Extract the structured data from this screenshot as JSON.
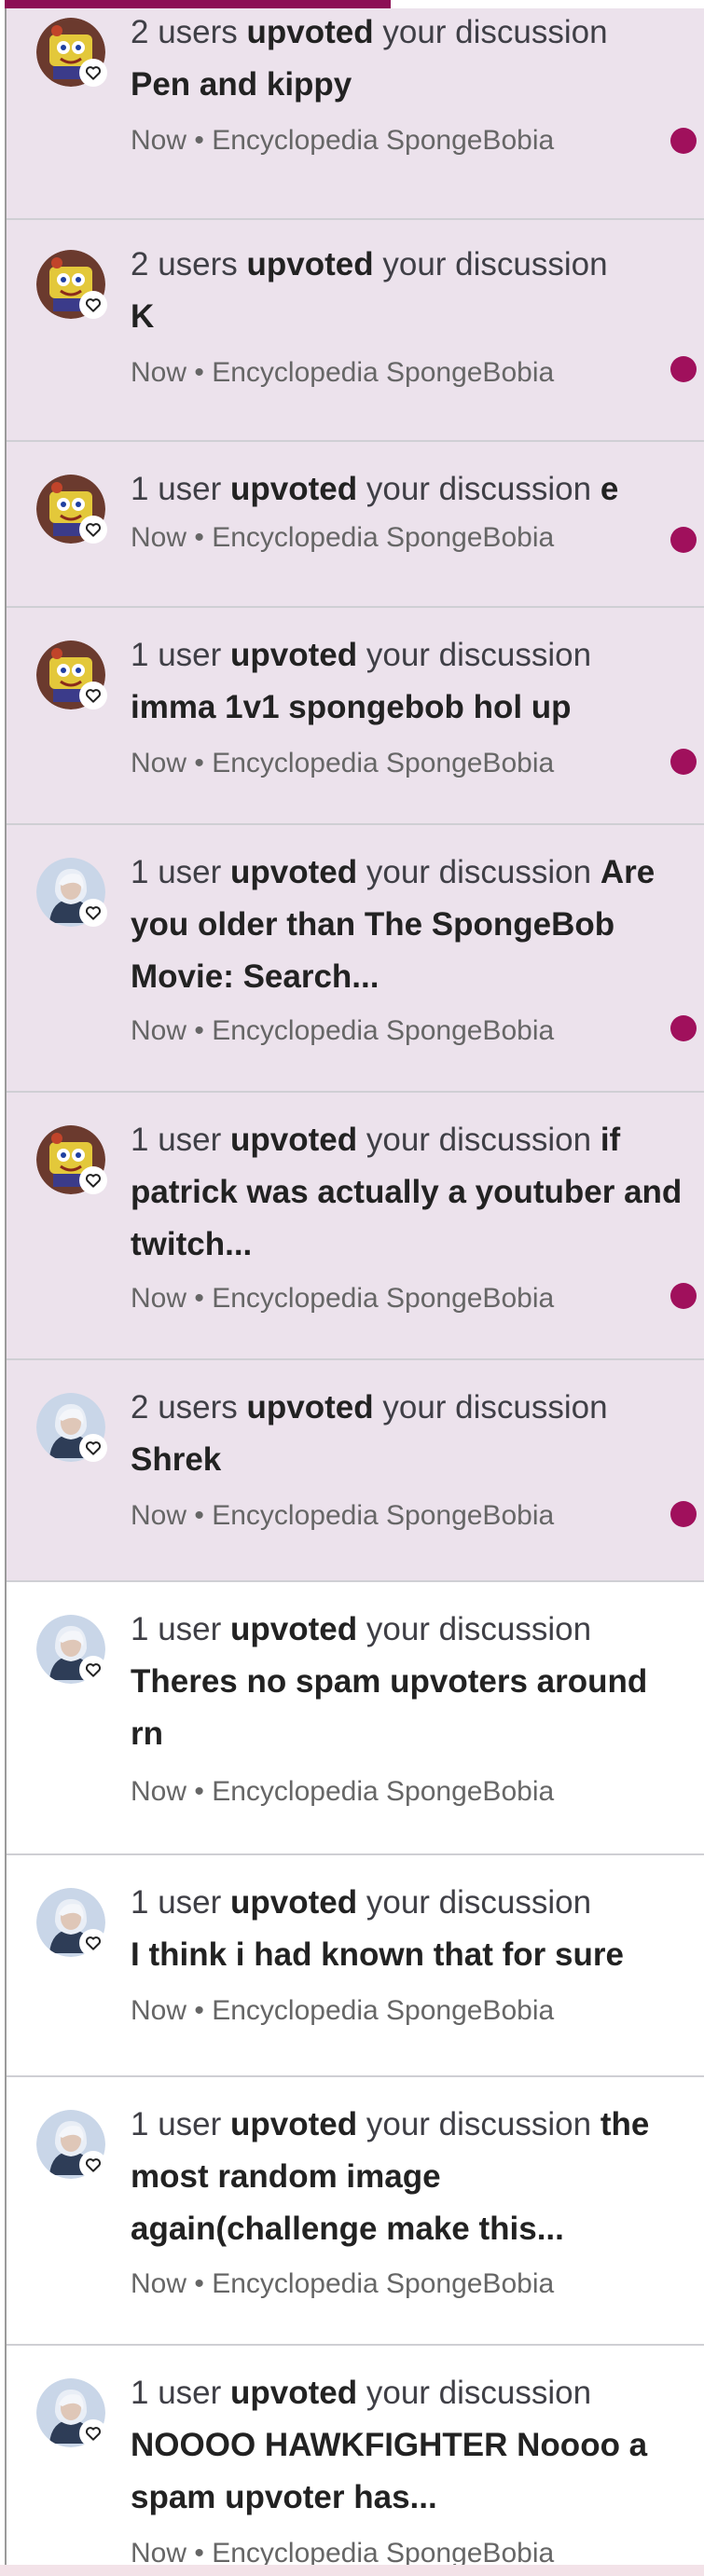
{
  "notifications": [
    {
      "count": "2 users",
      "action": "upvoted",
      "suffix": "your discussion",
      "title": "Pen and kippy",
      "time": "Now",
      "site": "Encyclopedia SpongeBobia",
      "unread": true,
      "avatar": "cartoon-avatar"
    },
    {
      "count": "2 users",
      "action": "upvoted",
      "suffix": "your discussion",
      "title": "K",
      "time": "Now",
      "site": "Encyclopedia SpongeBobia",
      "unread": true,
      "avatar": "cartoon-avatar"
    },
    {
      "count": "1 user",
      "action": "upvoted",
      "suffix": "your discussion",
      "title": "e",
      "time": "Now",
      "site": "Encyclopedia SpongeBobia",
      "unread": true,
      "avatar": "cartoon-avatar"
    },
    {
      "count": "1 user",
      "action": "upvoted",
      "suffix": "your discussion",
      "title": "imma 1v1 spongebob hol up",
      "time": "Now",
      "site": "Encyclopedia SpongeBobia",
      "unread": true,
      "avatar": "cartoon-avatar"
    },
    {
      "count": "1 user",
      "action": "upvoted",
      "suffix": "your discussion",
      "title": "Are you older than The SpongeBob Movie: Search...",
      "time": "Now",
      "site": "Encyclopedia SpongeBobia",
      "unread": true,
      "avatar": "person-avatar"
    },
    {
      "count": "1 user",
      "action": "upvoted",
      "suffix": "your discussion",
      "title": "if patrick was actually a youtuber and twitch...",
      "time": "Now",
      "site": "Encyclopedia SpongeBobia",
      "unread": true,
      "avatar": "cartoon-avatar"
    },
    {
      "count": "2 users",
      "action": "upvoted",
      "suffix": "your discussion",
      "title": "Shrek",
      "time": "Now",
      "site": "Encyclopedia SpongeBobia",
      "unread": true,
      "avatar": "person-avatar"
    },
    {
      "count": "1 user",
      "action": "upvoted",
      "suffix": "your discussion",
      "title": "Theres no spam upvoters around rn",
      "time": "Now",
      "site": "Encyclopedia SpongeBobia",
      "unread": false,
      "avatar": "person-avatar"
    },
    {
      "count": "1 user",
      "action": "upvoted",
      "suffix": "your discussion",
      "title": "I think i had known that for sure",
      "time": "Now",
      "site": "Encyclopedia SpongeBobia",
      "unread": false,
      "avatar": "person-avatar"
    },
    {
      "count": "1 user",
      "action": "upvoted",
      "suffix": "your discussion",
      "title": "the most random image again(challenge make this...",
      "time": "Now",
      "site": "Encyclopedia SpongeBobia",
      "unread": false,
      "avatar": "person-avatar"
    },
    {
      "count": "1 user",
      "action": "upvoted",
      "suffix": "your discussion",
      "title": "NOOOO HAWKFIGHTER Noooo a spam upvoter has...",
      "time": "Now",
      "site": "Encyclopedia SpongeBobia",
      "unread": false,
      "avatar": "person-avatar"
    }
  ],
  "separator": "•",
  "colors": {
    "unread_bg": "#ece2ec",
    "accent": "#8c0f55",
    "dot": "#a0105c"
  },
  "icons": {
    "badge": "heart-outline-icon"
  }
}
